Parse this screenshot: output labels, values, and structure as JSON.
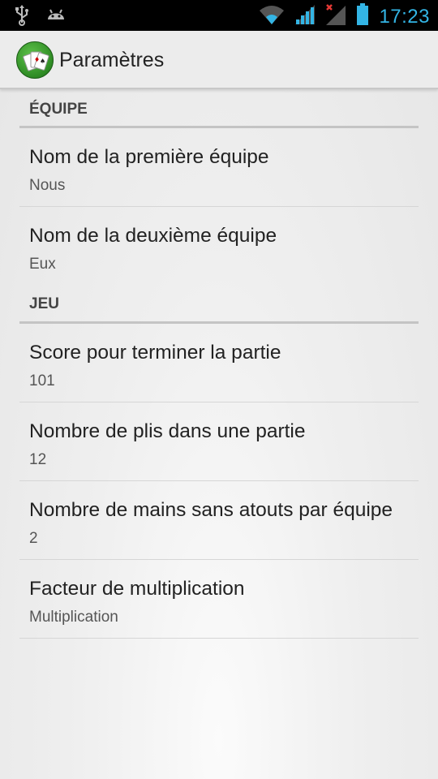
{
  "status_bar": {
    "time": "17:23",
    "icons": [
      "usb-icon",
      "android-debug-icon",
      "wifi-icon",
      "signal-icon",
      "signal-no-data-icon",
      "battery-icon"
    ]
  },
  "action_bar": {
    "title": "Paramètres",
    "app_icon": "playing-cards-icon"
  },
  "sections": [
    {
      "header": "ÉQUIPE",
      "items": [
        {
          "title": "Nom de la première équipe",
          "summary": "Nous"
        },
        {
          "title": "Nom de la deuxième équipe",
          "summary": "Eux"
        }
      ]
    },
    {
      "header": "JEU",
      "items": [
        {
          "title": "Score pour terminer la partie",
          "summary": "101"
        },
        {
          "title": "Nombre de plis dans une partie",
          "summary": "12"
        },
        {
          "title": "Nombre de mains sans atouts par équipe",
          "summary": "2"
        },
        {
          "title": "Facteur de multiplication",
          "summary": "Multiplication"
        }
      ]
    }
  ],
  "colors": {
    "accent": "#33b5e5",
    "status_bar_bg": "#000000"
  }
}
